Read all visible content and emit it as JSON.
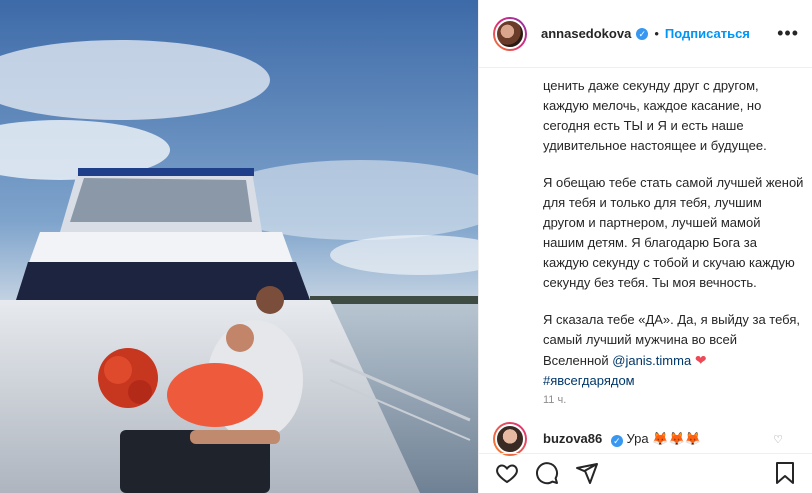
{
  "header": {
    "username": "annasedokova",
    "verified_icon": "verified-badge-icon",
    "separator": "•",
    "follow_label": "Подписаться",
    "more_label": "•••"
  },
  "caption": {
    "top_lines": "ценить даже секунду друг с другом, каждую мелочь, каждое касание, но сегодня есть ТЫ и Я и есть наше удивительное настоящее и будущее.",
    "para2": "Я обещаю тебе стать самой лучшей женой для тебя и только для тебя, лучшим другом и партнером, лучшей мамой нашим детям. Я благодарю Бога за каждую секунду с тобой и скучаю каждую секунду без тебя. Ты моя вечность.",
    "para3_text": "Я сказала тебе «ДА». Да, я выйду за тебя, самый лучший мужчина во всей Вселенной ",
    "mention": "@janis.timma",
    "heart": "❤",
    "hashtag": "#явсегдарядом"
  },
  "timestamp": "11 ч.",
  "comment": {
    "username": "buzova86",
    "text": "Ура",
    "emoji": "🦊🦊🦊"
  },
  "actions": {
    "like": "heart-outline-icon",
    "comment": "comment-icon",
    "share": "share-icon",
    "save": "bookmark-icon"
  },
  "colors": {
    "accent": "#0095f6",
    "link": "#00376b",
    "heart": "#ed4956",
    "muted": "#8e8e8e"
  }
}
